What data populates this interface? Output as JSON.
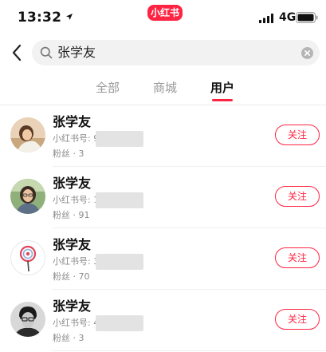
{
  "status_bar": {
    "time": "13:32",
    "app_badge": "小红书",
    "network": "4G"
  },
  "search": {
    "query": "张学友"
  },
  "tabs": [
    {
      "label": "全部",
      "active": false
    },
    {
      "label": "商城",
      "active": false
    },
    {
      "label": "用户",
      "active": true
    }
  ],
  "users": [
    {
      "name": "张学友",
      "id_label": "小红书号: 9",
      "fans": "粉丝 · 3",
      "follow_label": "关注",
      "avatar_icon": "photo-avatar-icon"
    },
    {
      "name": "张学友",
      "id_label": "小红书号: 1",
      "fans": "粉丝 · 91",
      "follow_label": "关注",
      "avatar_icon": "photo-avatar-icon"
    },
    {
      "name": "张学友",
      "id_label": "小红书号: 3",
      "fans": "粉丝 · 70",
      "follow_label": "关注",
      "avatar_icon": "lollipop-avatar-icon"
    },
    {
      "name": "张学友",
      "id_label": "小红书号: 4",
      "fans": "粉丝 · 3",
      "follow_label": "关注",
      "avatar_icon": "photo-avatar-icon"
    }
  ],
  "colors": {
    "accent": "#ff2442",
    "muted_text": "#8a8a8a",
    "search_bg": "#f2f2f2"
  }
}
